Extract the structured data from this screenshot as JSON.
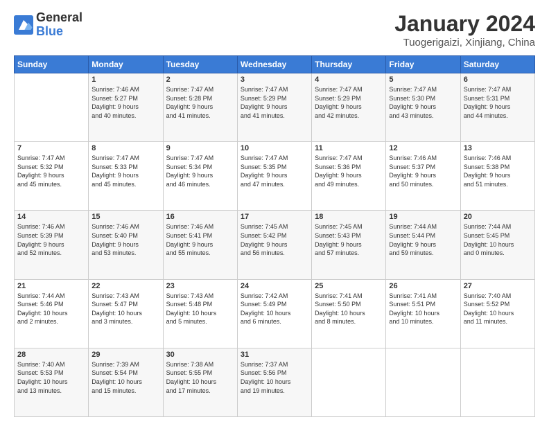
{
  "header": {
    "logo_general": "General",
    "logo_blue": "Blue",
    "month_title": "January 2024",
    "location": "Tuogerigaizi, Xinjiang, China"
  },
  "weekdays": [
    "Sunday",
    "Monday",
    "Tuesday",
    "Wednesday",
    "Thursday",
    "Friday",
    "Saturday"
  ],
  "weeks": [
    [
      {
        "day": "",
        "sunrise": "",
        "sunset": "",
        "daylight": ""
      },
      {
        "day": "1",
        "sunrise": "Sunrise: 7:46 AM",
        "sunset": "Sunset: 5:27 PM",
        "daylight": "Daylight: 9 hours and 40 minutes."
      },
      {
        "day": "2",
        "sunrise": "Sunrise: 7:47 AM",
        "sunset": "Sunset: 5:28 PM",
        "daylight": "Daylight: 9 hours and 41 minutes."
      },
      {
        "day": "3",
        "sunrise": "Sunrise: 7:47 AM",
        "sunset": "Sunset: 5:29 PM",
        "daylight": "Daylight: 9 hours and 41 minutes."
      },
      {
        "day": "4",
        "sunrise": "Sunrise: 7:47 AM",
        "sunset": "Sunset: 5:29 PM",
        "daylight": "Daylight: 9 hours and 42 minutes."
      },
      {
        "day": "5",
        "sunrise": "Sunrise: 7:47 AM",
        "sunset": "Sunset: 5:30 PM",
        "daylight": "Daylight: 9 hours and 43 minutes."
      },
      {
        "day": "6",
        "sunrise": "Sunrise: 7:47 AM",
        "sunset": "Sunset: 5:31 PM",
        "daylight": "Daylight: 9 hours and 44 minutes."
      }
    ],
    [
      {
        "day": "7",
        "sunrise": "Sunrise: 7:47 AM",
        "sunset": "Sunset: 5:32 PM",
        "daylight": "Daylight: 9 hours and 45 minutes."
      },
      {
        "day": "8",
        "sunrise": "Sunrise: 7:47 AM",
        "sunset": "Sunset: 5:33 PM",
        "daylight": "Daylight: 9 hours and 45 minutes."
      },
      {
        "day": "9",
        "sunrise": "Sunrise: 7:47 AM",
        "sunset": "Sunset: 5:34 PM",
        "daylight": "Daylight: 9 hours and 46 minutes."
      },
      {
        "day": "10",
        "sunrise": "Sunrise: 7:47 AM",
        "sunset": "Sunset: 5:35 PM",
        "daylight": "Daylight: 9 hours and 47 minutes."
      },
      {
        "day": "11",
        "sunrise": "Sunrise: 7:47 AM",
        "sunset": "Sunset: 5:36 PM",
        "daylight": "Daylight: 9 hours and 49 minutes."
      },
      {
        "day": "12",
        "sunrise": "Sunrise: 7:46 AM",
        "sunset": "Sunset: 5:37 PM",
        "daylight": "Daylight: 9 hours and 50 minutes."
      },
      {
        "day": "13",
        "sunrise": "Sunrise: 7:46 AM",
        "sunset": "Sunset: 5:38 PM",
        "daylight": "Daylight: 9 hours and 51 minutes."
      }
    ],
    [
      {
        "day": "14",
        "sunrise": "Sunrise: 7:46 AM",
        "sunset": "Sunset: 5:39 PM",
        "daylight": "Daylight: 9 hours and 52 minutes."
      },
      {
        "day": "15",
        "sunrise": "Sunrise: 7:46 AM",
        "sunset": "Sunset: 5:40 PM",
        "daylight": "Daylight: 9 hours and 53 minutes."
      },
      {
        "day": "16",
        "sunrise": "Sunrise: 7:46 AM",
        "sunset": "Sunset: 5:41 PM",
        "daylight": "Daylight: 9 hours and 55 minutes."
      },
      {
        "day": "17",
        "sunrise": "Sunrise: 7:45 AM",
        "sunset": "Sunset: 5:42 PM",
        "daylight": "Daylight: 9 hours and 56 minutes."
      },
      {
        "day": "18",
        "sunrise": "Sunrise: 7:45 AM",
        "sunset": "Sunset: 5:43 PM",
        "daylight": "Daylight: 9 hours and 57 minutes."
      },
      {
        "day": "19",
        "sunrise": "Sunrise: 7:44 AM",
        "sunset": "Sunset: 5:44 PM",
        "daylight": "Daylight: 9 hours and 59 minutes."
      },
      {
        "day": "20",
        "sunrise": "Sunrise: 7:44 AM",
        "sunset": "Sunset: 5:45 PM",
        "daylight": "Daylight: 10 hours and 0 minutes."
      }
    ],
    [
      {
        "day": "21",
        "sunrise": "Sunrise: 7:44 AM",
        "sunset": "Sunset: 5:46 PM",
        "daylight": "Daylight: 10 hours and 2 minutes."
      },
      {
        "day": "22",
        "sunrise": "Sunrise: 7:43 AM",
        "sunset": "Sunset: 5:47 PM",
        "daylight": "Daylight: 10 hours and 3 minutes."
      },
      {
        "day": "23",
        "sunrise": "Sunrise: 7:43 AM",
        "sunset": "Sunset: 5:48 PM",
        "daylight": "Daylight: 10 hours and 5 minutes."
      },
      {
        "day": "24",
        "sunrise": "Sunrise: 7:42 AM",
        "sunset": "Sunset: 5:49 PM",
        "daylight": "Daylight: 10 hours and 6 minutes."
      },
      {
        "day": "25",
        "sunrise": "Sunrise: 7:41 AM",
        "sunset": "Sunset: 5:50 PM",
        "daylight": "Daylight: 10 hours and 8 minutes."
      },
      {
        "day": "26",
        "sunrise": "Sunrise: 7:41 AM",
        "sunset": "Sunset: 5:51 PM",
        "daylight": "Daylight: 10 hours and 10 minutes."
      },
      {
        "day": "27",
        "sunrise": "Sunrise: 7:40 AM",
        "sunset": "Sunset: 5:52 PM",
        "daylight": "Daylight: 10 hours and 11 minutes."
      }
    ],
    [
      {
        "day": "28",
        "sunrise": "Sunrise: 7:40 AM",
        "sunset": "Sunset: 5:53 PM",
        "daylight": "Daylight: 10 hours and 13 minutes."
      },
      {
        "day": "29",
        "sunrise": "Sunrise: 7:39 AM",
        "sunset": "Sunset: 5:54 PM",
        "daylight": "Daylight: 10 hours and 15 minutes."
      },
      {
        "day": "30",
        "sunrise": "Sunrise: 7:38 AM",
        "sunset": "Sunset: 5:55 PM",
        "daylight": "Daylight: 10 hours and 17 minutes."
      },
      {
        "day": "31",
        "sunrise": "Sunrise: 7:37 AM",
        "sunset": "Sunset: 5:56 PM",
        "daylight": "Daylight: 10 hours and 19 minutes."
      },
      {
        "day": "",
        "sunrise": "",
        "sunset": "",
        "daylight": ""
      },
      {
        "day": "",
        "sunrise": "",
        "sunset": "",
        "daylight": ""
      },
      {
        "day": "",
        "sunrise": "",
        "sunset": "",
        "daylight": ""
      }
    ]
  ]
}
